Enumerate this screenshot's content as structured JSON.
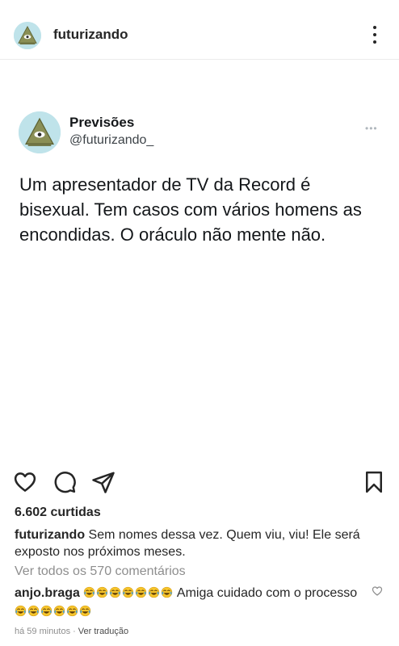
{
  "header": {
    "username": "futurizando",
    "avatar_icon": "illuminati-eye-icon",
    "more_icon": "more-vertical-icon"
  },
  "tweet": {
    "display_name": "Previsões",
    "handle": "@futurizando_",
    "more_icon": "more-horizontal-icon",
    "text": "Um apresentador de TV da Record é bisexual. Tem casos com vários homens as encondidas. O oráculo não mente não."
  },
  "actions": {
    "like_icon": "heart-icon",
    "comment_icon": "comment-icon",
    "share_icon": "paper-plane-icon",
    "save_icon": "bookmark-icon"
  },
  "likes_text": "6.602 curtidas",
  "caption": {
    "username": "futurizando",
    "text": "Sem nomes dessa vez. Quem viu, viu! Ele será exposto nos próximos meses."
  },
  "view_comments": "Ver todos os 570 comentários",
  "comment": {
    "username": "anjo.braga",
    "emoji_icon": "tears-of-joy-emoji",
    "leading_emoji_count": 7,
    "text": "Amiga cuidado com o processo",
    "trailing_emoji_count": 6
  },
  "meta": {
    "time": "há 59 minutos",
    "separator": "·",
    "translate": "Ver tradução"
  },
  "colors": {
    "text": "#262626",
    "secondary": "#8e8e8e",
    "avatar_bg": "#bfe3ea",
    "emoji_face": "#f7c52b",
    "emoji_tears": "#4aa3df"
  }
}
